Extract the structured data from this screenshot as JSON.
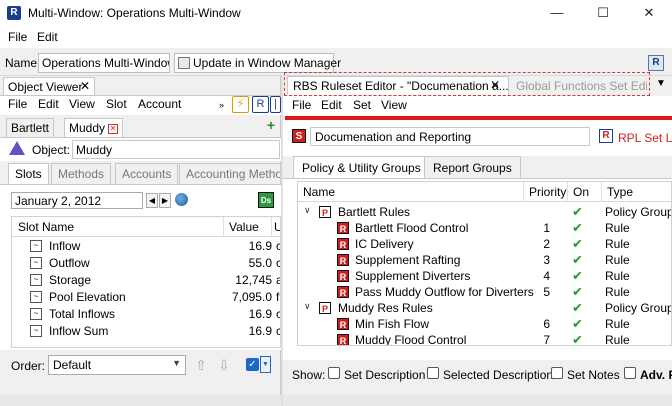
{
  "window": {
    "title": "Multi-Window: Operations Multi-Window",
    "app_icon": "R",
    "minimize": "—",
    "maximize": "☐",
    "close": "✕"
  },
  "menubar": {
    "file": "File",
    "edit": "Edit"
  },
  "namebar": {
    "label": "Name:",
    "value": "Operations Multi-Window",
    "update_button": "Update in Window Manager"
  },
  "object_viewer": {
    "tab_label": "Object Viewer",
    "menu": [
      "File",
      "Edit",
      "View",
      "Slot",
      "Account"
    ],
    "object_tabs": [
      "Bartlett",
      "Muddy"
    ],
    "object_label": "Object:",
    "object_value": "Muddy",
    "subtabs": [
      "Slots",
      "Methods",
      "Accounts",
      "Accounting Metho"
    ],
    "date": "January 2, 2012",
    "ds_label": "Ds",
    "slot_header": {
      "name": "Slot Name",
      "value": "Value",
      "unit": "U"
    },
    "slots": [
      {
        "name": "Inflow",
        "value": "16.9",
        "unit": "c"
      },
      {
        "name": "Outflow",
        "value": "55.0",
        "unit": "c"
      },
      {
        "name": "Storage",
        "value": "12,745",
        "unit": "a"
      },
      {
        "name": "Pool Elevation",
        "value": "7,095.0",
        "unit": "f"
      },
      {
        "name": "Total Inflows",
        "value": "16.9",
        "unit": "c"
      },
      {
        "name": "Inflow Sum",
        "value": "16.9",
        "unit": "c"
      }
    ],
    "order_label": "Order:",
    "order_value": "Default"
  },
  "rbs_editor": {
    "tab_label": "RBS Ruleset Editor - \"Documenation a...",
    "tab2_label": "Global Functions Set Edit...",
    "menu": [
      "File",
      "Edit",
      "Set",
      "View"
    ],
    "ruleset_name": "Documenation and Reporting",
    "rpl_label": "RPL Set Lo",
    "group_tabs": [
      "Policy & Utility Groups",
      "Report Groups"
    ],
    "columns": {
      "name": "Name",
      "priority": "Priority",
      "on": "On",
      "type": "Type"
    },
    "rows": [
      {
        "level": 0,
        "name": "Bartlett Rules",
        "priority": "",
        "on": "✔",
        "type": "Policy Group"
      },
      {
        "level": 1,
        "name": "Bartlett Flood Control",
        "priority": "1",
        "on": "✔",
        "type": "Rule"
      },
      {
        "level": 1,
        "name": "IC Delivery",
        "priority": "2",
        "on": "✔",
        "type": "Rule"
      },
      {
        "level": 1,
        "name": "Supplement Rafting",
        "priority": "3",
        "on": "✔",
        "type": "Rule"
      },
      {
        "level": 1,
        "name": "Supplement Diverters",
        "priority": "4",
        "on": "✔",
        "type": "Rule"
      },
      {
        "level": 1,
        "name": "Pass Muddy Outflow for Diverters",
        "priority": "5",
        "on": "✔",
        "type": "Rule"
      },
      {
        "level": 0,
        "name": "Muddy Res Rules",
        "priority": "",
        "on": "✔",
        "type": "Policy Group"
      },
      {
        "level": 1,
        "name": "Min Fish Flow",
        "priority": "6",
        "on": "✔",
        "type": "Rule"
      },
      {
        "level": 1,
        "name": "Muddy Flood Control",
        "priority": "7",
        "on": "✔",
        "type": "Rule"
      }
    ],
    "show_label": "Show:",
    "checkboxes": [
      "Set Description",
      "Selected Description",
      "Set Notes",
      "Adv. P"
    ]
  }
}
